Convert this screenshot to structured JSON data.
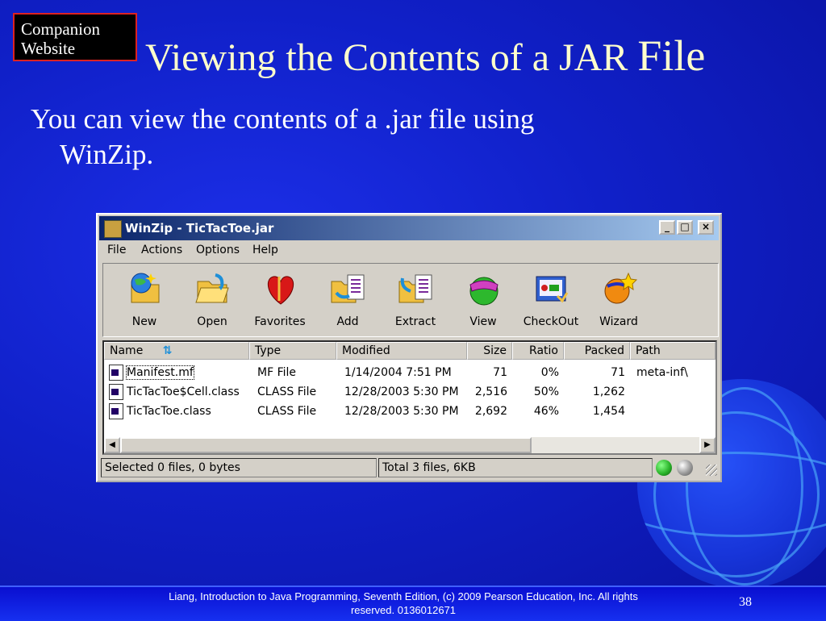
{
  "slide": {
    "badge": [
      "Companion",
      "Website"
    ],
    "title_main": "Viewing the Contents of a JAR",
    "title_last": "File",
    "bullet_line1": "You can view the contents of a .jar file using",
    "bullet_line2": "WinZip.",
    "footer": "Liang, Introduction to Java Programming, Seventh Edition, (c) 2009 Pearson Education, Inc. All rights reserved. 0136012671",
    "page_number": "38"
  },
  "window": {
    "title": "WinZip - TicTacToe.jar",
    "controls": {
      "minimize": "_",
      "maximize": "□",
      "close": "×"
    },
    "menu": [
      {
        "label": "File",
        "icon": ""
      },
      {
        "label": "Actions",
        "icon": ""
      },
      {
        "label": "Options",
        "icon": ""
      },
      {
        "label": "Help",
        "icon": ""
      }
    ],
    "toolbar": [
      {
        "label": "New",
        "icon": "new-globe-folder-icon"
      },
      {
        "label": "Open",
        "icon": "open-folder-icon"
      },
      {
        "label": "Favorites",
        "icon": "favorites-heart-icon"
      },
      {
        "label": "Add",
        "icon": "add-files-icon"
      },
      {
        "label": "Extract",
        "icon": "extract-files-icon"
      },
      {
        "label": "View",
        "icon": "view-goggles-icon"
      },
      {
        "label": "CheckOut",
        "icon": "checkout-icon"
      },
      {
        "label": "Wizard",
        "icon": "wizard-icon"
      }
    ],
    "columns": [
      "Name",
      "Type",
      "Modified",
      "Size",
      "Ratio",
      "Packed",
      "Path"
    ],
    "files": [
      {
        "name": "Manifest.mf",
        "type": "MF File",
        "modified": "1/14/2004 7:51 PM",
        "size": "71",
        "ratio": "0%",
        "packed": "71",
        "path": "meta-inf\\"
      },
      {
        "name": "TicTacToe$Cell.class",
        "type": "CLASS File",
        "modified": "12/28/2003 5:30 PM",
        "size": "2,516",
        "ratio": "50%",
        "packed": "1,262",
        "path": ""
      },
      {
        "name": "TicTacToe.class",
        "type": "CLASS File",
        "modified": "12/28/2003 5:30 PM",
        "size": "2,692",
        "ratio": "46%",
        "packed": "1,454",
        "path": ""
      }
    ],
    "status_left": "Selected 0 files, 0 bytes",
    "status_right": "Total 3 files, 6KB",
    "colors": {
      "led_green": "#2bb52b",
      "led_gray": "#9a9a9a",
      "titlebar": "#0a246a"
    }
  }
}
